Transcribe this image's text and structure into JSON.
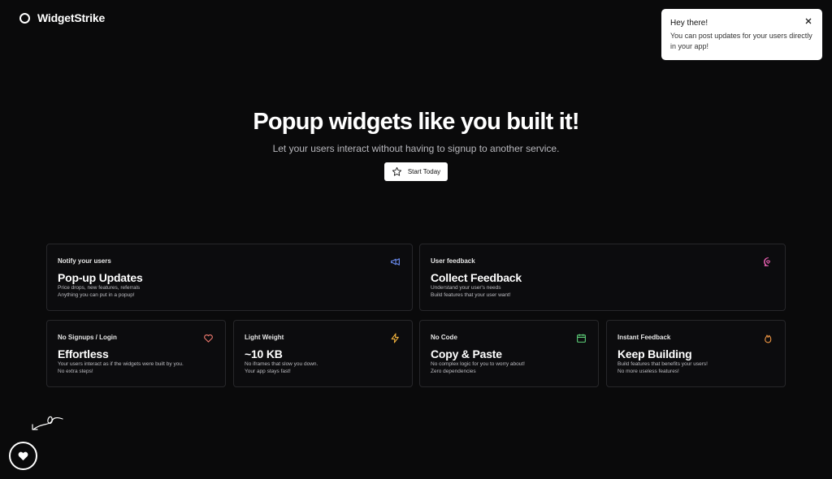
{
  "brand": {
    "name": "WidgetStrike",
    "logo_icon": "circle-outline-icon"
  },
  "toast": {
    "title": "Hey there!",
    "body": "You can post updates for your users directly in your app!",
    "close_icon": "close-icon"
  },
  "hero": {
    "title": "Popup widgets like you built it!",
    "subtitle": "Let your users interact without having to signup to another service.",
    "cta_label": "Start Today",
    "cta_icon": "star-icon"
  },
  "features": [
    {
      "eyebrow": "Notify your users",
      "title": "Pop-up Updates",
      "lines": [
        "Price drops, new features, referrals",
        "Anything you can put in a popup!"
      ],
      "icon": "megaphone-icon",
      "icon_color": "#6b8df2"
    },
    {
      "eyebrow": "User feedback",
      "title": "Collect Feedback",
      "lines": [
        "Understand your user's needs",
        "Build features that your user want!"
      ],
      "icon": "chat-heart-icon",
      "icon_color": "#e65fb0"
    },
    {
      "eyebrow": "No Signups / Login",
      "title": "Effortless",
      "lines": [
        "Your users interact as if the widgets were built by you.",
        "No extra steps!"
      ],
      "icon": "heart-icon",
      "icon_color": "#f07a6f"
    },
    {
      "eyebrow": "Light Weight",
      "title": "~10 KB",
      "lines": [
        "No iframes that slow you down.",
        "Your app stays fast!"
      ],
      "icon": "bolt-icon",
      "icon_color": "#f2b33d"
    },
    {
      "eyebrow": "No Code",
      "title": "Copy & Paste",
      "lines": [
        "No complex logic for you to worry about!",
        "Zero dependencies"
      ],
      "icon": "calendar-icon",
      "icon_color": "#5ed17a"
    },
    {
      "eyebrow": "Instant Feedback",
      "title": "Keep Building",
      "lines": [
        "Build features that benefits your users!",
        "No more useless features!"
      ],
      "icon": "flame-icon",
      "icon_color": "#f59a45"
    }
  ],
  "fab": {
    "icon": "heart-filled-icon"
  }
}
